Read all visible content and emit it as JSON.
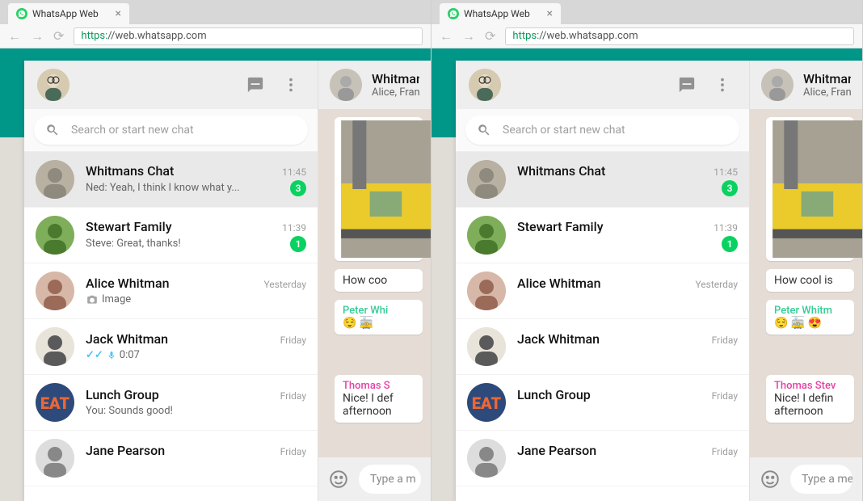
{
  "browser": {
    "tab_title": "WhatsApp Web",
    "url_https": "https:",
    "url_rest": "//web.whatsapp.com"
  },
  "sidebar": {
    "search_placeholder": "Search or start new chat",
    "chats": [
      {
        "name": "Whitmans Chat",
        "time": "11:45",
        "preview_mode": "text",
        "preview": "Ned: Yeah, I think I know what y...",
        "badge": "3",
        "selected": true
      },
      {
        "name": "Stewart Family",
        "time": "11:39",
        "preview_mode": "text",
        "preview": "Steve: Great, thanks!",
        "badge": "1"
      },
      {
        "name": "Alice Whitman",
        "time": "Yesterday",
        "preview_mode": "image",
        "preview": "Image"
      },
      {
        "name": "Jack Whitman",
        "time": "Friday",
        "preview_mode": "voice",
        "preview": "0:07"
      },
      {
        "name": "Lunch Group",
        "time": "Friday",
        "preview_mode": "text",
        "preview": "You: Sounds good!"
      },
      {
        "name": "Jane Pearson",
        "time": "Friday",
        "preview_mode": "none"
      }
    ]
  },
  "conversation": {
    "title_left": "Whitman",
    "title_right": "Whitmans",
    "subtitle_left": "Alice, Franc",
    "subtitle_right": "Alice, Francis,",
    "msg1_left": "How coo",
    "msg1_right": "How cool is",
    "msg2_sender_left": "Peter Whi",
    "msg2_sender_right": "Peter Whitm",
    "msg2_body_left": "😌 🚋",
    "msg2_body_right": "😌 🚋 😍",
    "msg3_sender_left": "Thomas S",
    "msg3_sender_right": "Thomas Stev",
    "msg3_body_left": "Nice! I def",
    "msg3_body_right": "Nice! I defin",
    "msg3_body2": "afternoon",
    "input_placeholder_left": "Type a m",
    "input_placeholder_right": "Type a mes"
  }
}
